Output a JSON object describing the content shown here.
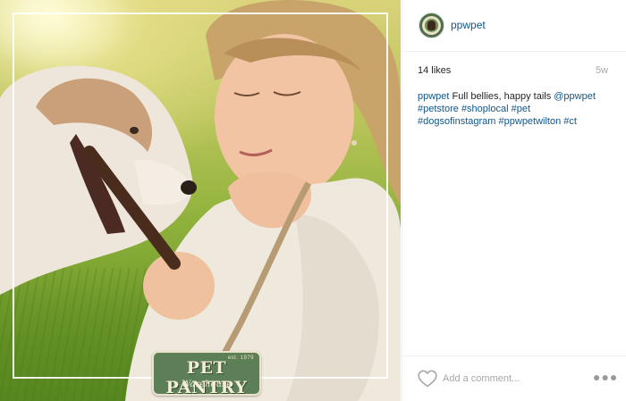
{
  "post": {
    "photo": {
      "badge": {
        "est": "est. 1979",
        "name": "PET PANTRY",
        "subtitle": "Warehouse"
      }
    },
    "author": {
      "username": "ppwpet"
    },
    "likes": "14 likes",
    "age": "5w",
    "caption": {
      "author": "ppwpet",
      "text_1": " Full bellies, happy tails ",
      "mention": "@ppwpet",
      "tags": [
        "#petstore",
        "#shoplocal",
        "#pet",
        "#dogsofinstagram",
        "#ppwpetwilton",
        "#ct"
      ]
    },
    "comment": {
      "placeholder": "Add a comment..."
    },
    "icons": {
      "like": "heart-icon",
      "more": "more-options-icon"
    },
    "colors": {
      "link": "#125688",
      "muted": "#a5a7aa",
      "text": "#262626",
      "badge_green": "#5d7f57"
    }
  }
}
